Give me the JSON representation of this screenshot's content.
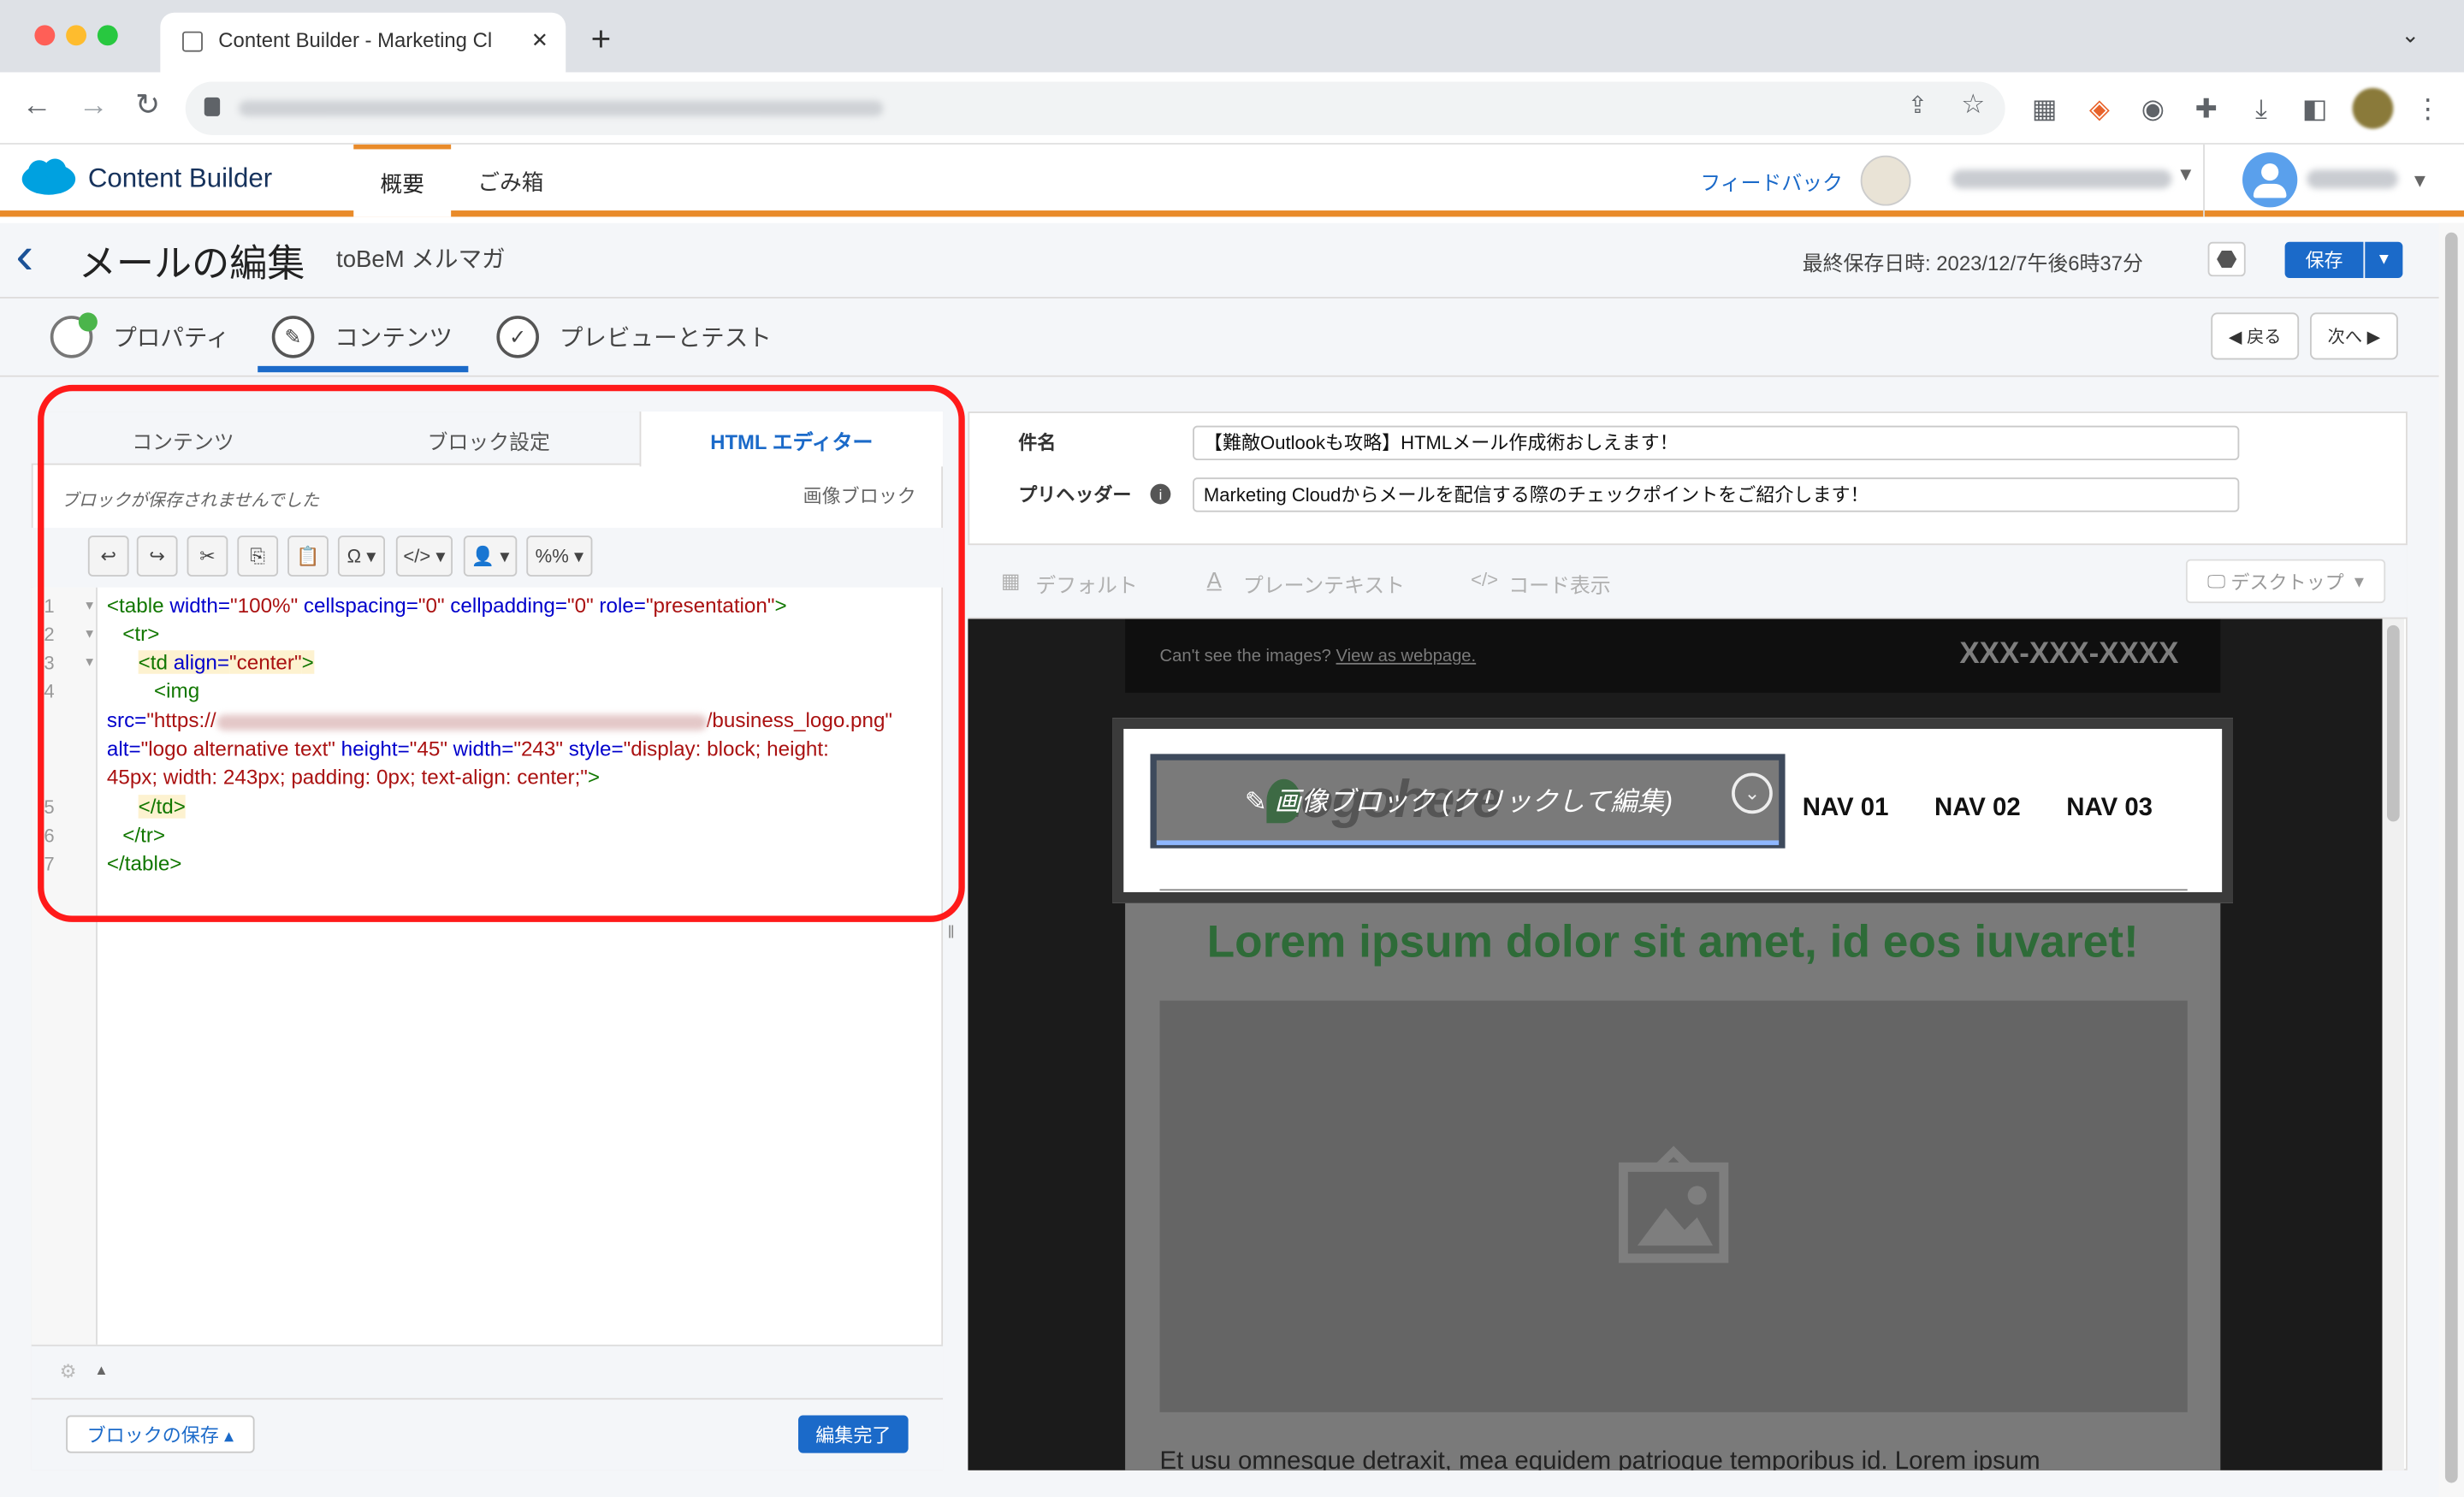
{
  "browser": {
    "tab_title": "Content Builder - Marketing Cl",
    "tab_close": "✕",
    "new_tab": "+",
    "colors": {
      "close": "#ff5f57",
      "minimize": "#febc2e",
      "maximize": "#28c840"
    }
  },
  "app": {
    "name": "Content Builder",
    "nav": {
      "overview": "概要",
      "trash": "ごみ箱"
    },
    "feedback": "フィードバック",
    "accent": "#e98b2a",
    "brand": "#1b96ff"
  },
  "page": {
    "title": "メールの編集",
    "subtitle": "toBeM メルマガ",
    "last_saved": "最終保存日時: 2023/12/7午後6時37分",
    "save_button": "保存",
    "steps": [
      "プロパティ",
      "コンテンツ",
      "プレビューとテスト"
    ],
    "back_button": "戻る",
    "next_button": "次へ"
  },
  "left_panel": {
    "tabs": [
      "コンテンツ",
      "ブロック設定",
      "HTML エディター"
    ],
    "status": "ブロックが保存されませんでした",
    "block_type": "画像ブロック",
    "toolbar": {
      "special_char": "Ω",
      "code": "</>",
      "personalize": "👤",
      "percent": "%%"
    },
    "line_numbers": [
      "1",
      "2",
      "3",
      "4",
      "5",
      "6",
      "7"
    ],
    "code": {
      "l1_tag": "<table",
      "l1_a1": " width=",
      "l1_v1": "\"100%\"",
      "l1_a2": " cellspacing=",
      "l1_v2": "\"0\"",
      "l1_a3": " cellpadding=",
      "l1_v3": "\"0\"",
      "l1_a4": " role=",
      "l1_v4": "\"presentation\"",
      "l1_end": ">",
      "l2": "<tr>",
      "l3_tag": "<td",
      "l3_a": " align=",
      "l3_v": "\"center\"",
      "l3_end": ">",
      "l4": "<img",
      "l4b_a": "src=",
      "l4b_v1": "\"https://",
      "l4b_v2": "/business_logo.png\"",
      "l4c_a1": "alt=",
      "l4c_v1": "\"logo alternative text\"",
      "l4c_a2": " height=",
      "l4c_v2": "\"45\"",
      "l4c_a3": " width=",
      "l4c_v3": "\"243\"",
      "l4c_a4": " style=",
      "l4c_v4": "\"display: block; height:",
      "l4d_v": "45px; width: 243px; padding: 0px; text-align: center;\"",
      "l4d_end": ">",
      "l5": "</td>",
      "l6": "</tr>",
      "l7": "</table>"
    },
    "save_block": "ブロックの保存 ▴",
    "done_button": "編集完了"
  },
  "right_panel": {
    "subject_label": "件名",
    "subject_value": "【難敵Outlookも攻略】HTMLメール作成術おしえます！",
    "preheader_label": "プリヘッダー",
    "preheader_value": "Marketing Cloudからメールを配信する際のチェックポイントをご紹介します！",
    "views": [
      "デフォルト",
      "プレーンテキスト",
      "コード表示"
    ],
    "device": "デスクトップ",
    "email": {
      "cant_see": "Can't see the images?",
      "view_webpage": "View as webpage.",
      "phone": "XXX-XXX-XXXX",
      "logo_text": "Logohere",
      "image_block_hint": "画像ブロック (クリックして編集)",
      "nav": [
        "NAV 01",
        "NAV 02",
        "NAV 03"
      ],
      "headline": "Lorem ipsum dolor sit amet, id eos iuvaret!",
      "body": "Et usu omnesque detraxit, mea equidem patrioque temporibus id. Lorem ipsum",
      "headline_color": "#2e6b38"
    }
  }
}
